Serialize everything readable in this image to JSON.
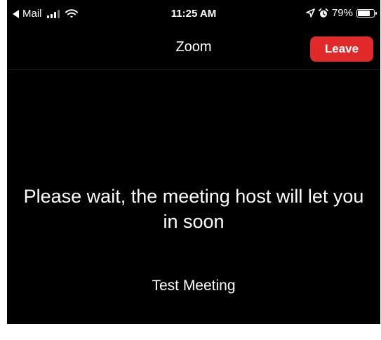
{
  "status_bar": {
    "back_app_label": "Mail",
    "time": "11:25 AM",
    "battery_text": "79%",
    "battery_level": 0.79
  },
  "nav": {
    "title": "Zoom",
    "leave_label": "Leave"
  },
  "content": {
    "wait_message": "Please wait, the meeting host will let you in soon",
    "meeting_name": "Test Meeting"
  },
  "colors": {
    "background": "#000000",
    "leave_button": "#e02a2a",
    "text": "#ffffff"
  },
  "icons": [
    "back-arrow-icon",
    "cellular-signal-icon",
    "wifi-icon",
    "location-arrow-icon",
    "alarm-clock-icon",
    "battery-icon"
  ]
}
